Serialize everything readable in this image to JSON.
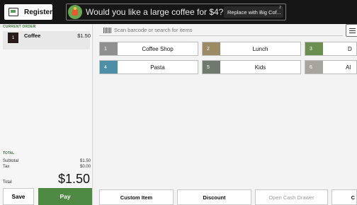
{
  "topbar": {
    "register_label": "Register",
    "promo_text": "Would you like a large coffee for $4?",
    "promo_button": "Replace with Big Cof...",
    "promo_badge": "2"
  },
  "order": {
    "header": "CURRENT ORDER",
    "items": [
      {
        "qty": "1",
        "name": "Coffee",
        "price": "$1.50"
      }
    ],
    "totals_header": "TOTAL",
    "subtotal_label": "Subtotal",
    "subtotal_value": "$1.50",
    "tax_label": "Tax",
    "tax_value": "$0.00",
    "total_label": "Total",
    "total_value": "$1.50",
    "save_label": "Save",
    "pay_label": "Pay"
  },
  "search": {
    "placeholder": "Scan barcode or search for items",
    "icon": "barcode-icon"
  },
  "categories": [
    {
      "num": "1",
      "label": "Coffee Shop",
      "color": "#8f8f8f"
    },
    {
      "num": "2",
      "label": "Lunch",
      "color": "#9b8a63"
    },
    {
      "num": "3",
      "label": "D",
      "color": "#6a8f4e"
    },
    {
      "num": "4",
      "label": "Pasta",
      "color": "#4e8fa8"
    },
    {
      "num": "5",
      "label": "Kids",
      "color": "#6f7a6c"
    },
    {
      "num": "6",
      "label": "Al",
      "color": "#a8a49e"
    }
  ],
  "bottom_actions": {
    "custom_item": "Custom Item",
    "discount": "Discount",
    "open_cash_drawer": "Open Cash Drawer",
    "partial": "C"
  },
  "colors": {
    "accent_green": "#4f8a44",
    "topbar": "#161616"
  }
}
